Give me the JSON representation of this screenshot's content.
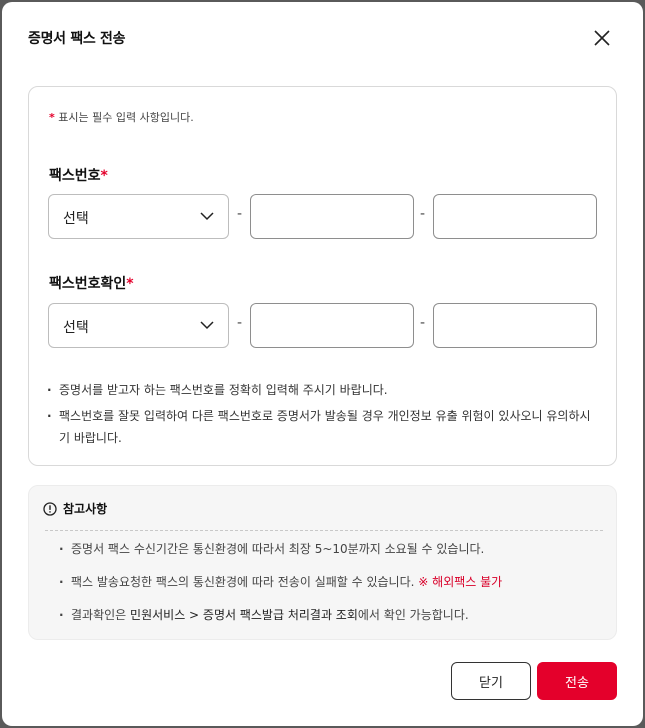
{
  "dialog": {
    "title": "증명서 팩스 전송"
  },
  "form": {
    "required_star": "*",
    "required_note": "표시는 필수 입력 사항입니다.",
    "fax_number": {
      "label": "팩스번호",
      "select_value": "선택",
      "separator": "-",
      "middle_value": "",
      "last_value": ""
    },
    "fax_confirm": {
      "label": "팩스번호확인",
      "select_value": "선택",
      "separator": "-",
      "middle_value": "",
      "last_value": ""
    },
    "notes": [
      "증명서를 받고자 하는 팩스번호를 정확히 입력해 주시기 바랍니다.",
      "팩스번호를 잘못 입력하여 다른 팩스번호로 증명서가 발송될 경우 개인정보 유출 위험이 있사오니 유의하시기 바랍니다."
    ]
  },
  "reference": {
    "title": "참고사항",
    "item1": "증명서 팩스 수신기간은 통신환경에 따라서 최장 5~10분까지 소요될 수 있습니다.",
    "item2_text": "팩스 발송요청한 팩스의 통신환경에 따라 전송이 실패할 수 있습니다.",
    "item2_warning": "※ 해외팩스 불가",
    "item3_prefix": "결과확인은",
    "item3_path": "민원서비스 > 증명서 팩스발급 처리결과 조회",
    "item3_suffix": "에서 확인 가능합니다."
  },
  "actions": {
    "close_label": "닫기",
    "send_label": "전송"
  },
  "colors": {
    "accent": "#e4002b",
    "warning_text": "#d9002a"
  }
}
